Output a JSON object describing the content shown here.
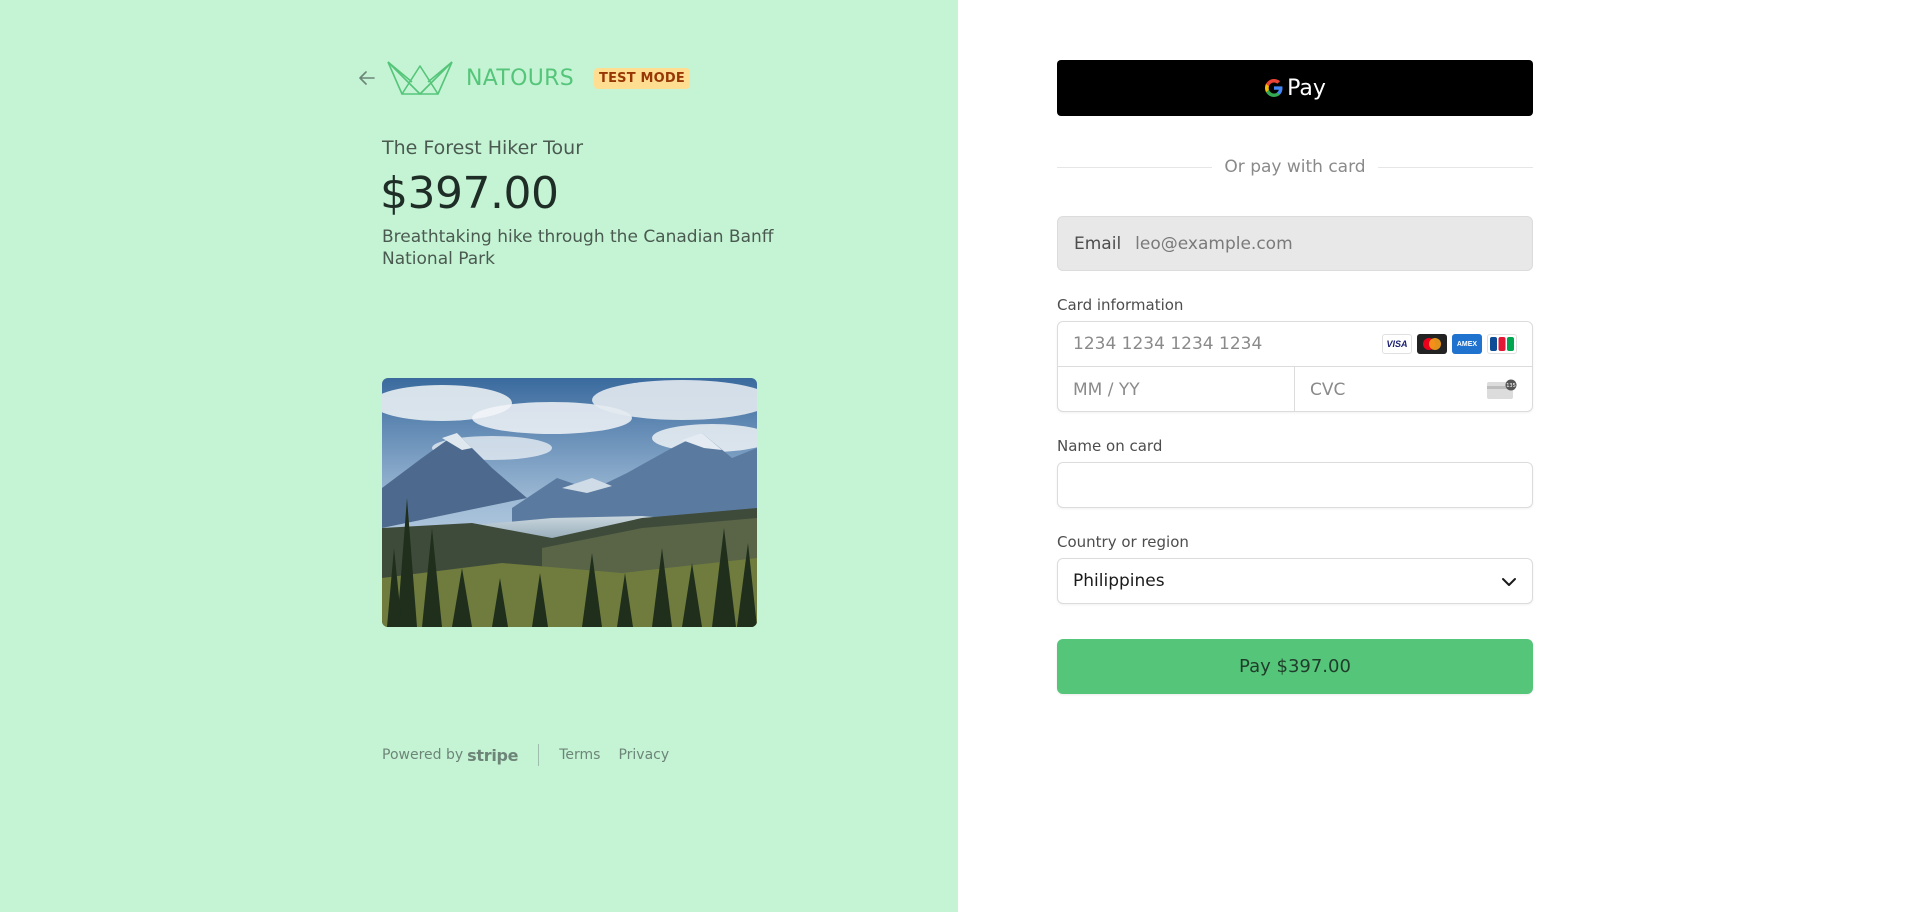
{
  "header": {
    "brand": "NATOURS",
    "badge": "TEST MODE",
    "back_icon": "arrow-left-icon",
    "logo_icon": "crown-logo-icon"
  },
  "product": {
    "name": "The Forest Hiker Tour",
    "price": "$397.00",
    "description": "Breathtaking hike through the Canadian Banff National Park"
  },
  "footer": {
    "powered_by": "Powered by",
    "stripe": "stripe",
    "terms": "Terms",
    "privacy": "Privacy"
  },
  "gpay": {
    "label": "Pay",
    "icon": "google-g-icon"
  },
  "divider": {
    "text": "Or pay with card"
  },
  "email": {
    "label": "Email",
    "value": "leo@example.com"
  },
  "card": {
    "label": "Card information",
    "number_placeholder": "1234 1234 1234 1234",
    "expiry_placeholder": "MM / YY",
    "cvc_placeholder": "CVC",
    "brands": [
      "visa",
      "mastercard",
      "amex",
      "jcb"
    ],
    "visa_text": "VISA",
    "amex_text": "AMEX",
    "cvc_badge": "135"
  },
  "name_on_card": {
    "label": "Name on card",
    "value": ""
  },
  "country": {
    "label": "Country or region",
    "selected": "Philippines"
  },
  "pay_button": {
    "label": "Pay $397.00"
  },
  "colors": {
    "left_bg": "#c5f4d4",
    "accent": "#55c57a",
    "badge_bg": "#ffde92",
    "badge_text": "#983705"
  }
}
